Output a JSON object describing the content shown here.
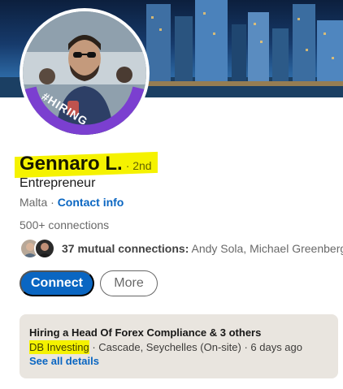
{
  "profile": {
    "name": "Gennaro L.",
    "degree": "· 2nd",
    "headline": "Entrepreneur",
    "location": "Malta ·",
    "contact_info": "Contact info",
    "connections": "500+ connections",
    "hiring_badge": "#HIRING"
  },
  "mutual": {
    "count_label": "37 mutual connections:",
    "names": "Andy Sola, Michael Greenberg, a"
  },
  "actions": {
    "connect": "Connect",
    "more": "More"
  },
  "hiring": {
    "title": "Hiring a Head Of Forex Compliance & 3 others",
    "company": "DB Investing",
    "details": "· Cascade, Seychelles (On-site) · 6 days ago",
    "see_all": "See all details"
  },
  "colors": {
    "primary": "#0a66c2",
    "highlight": "#f5f200",
    "hiring_ring": "#7b3fd0",
    "card_bg": "#e9e5df"
  }
}
